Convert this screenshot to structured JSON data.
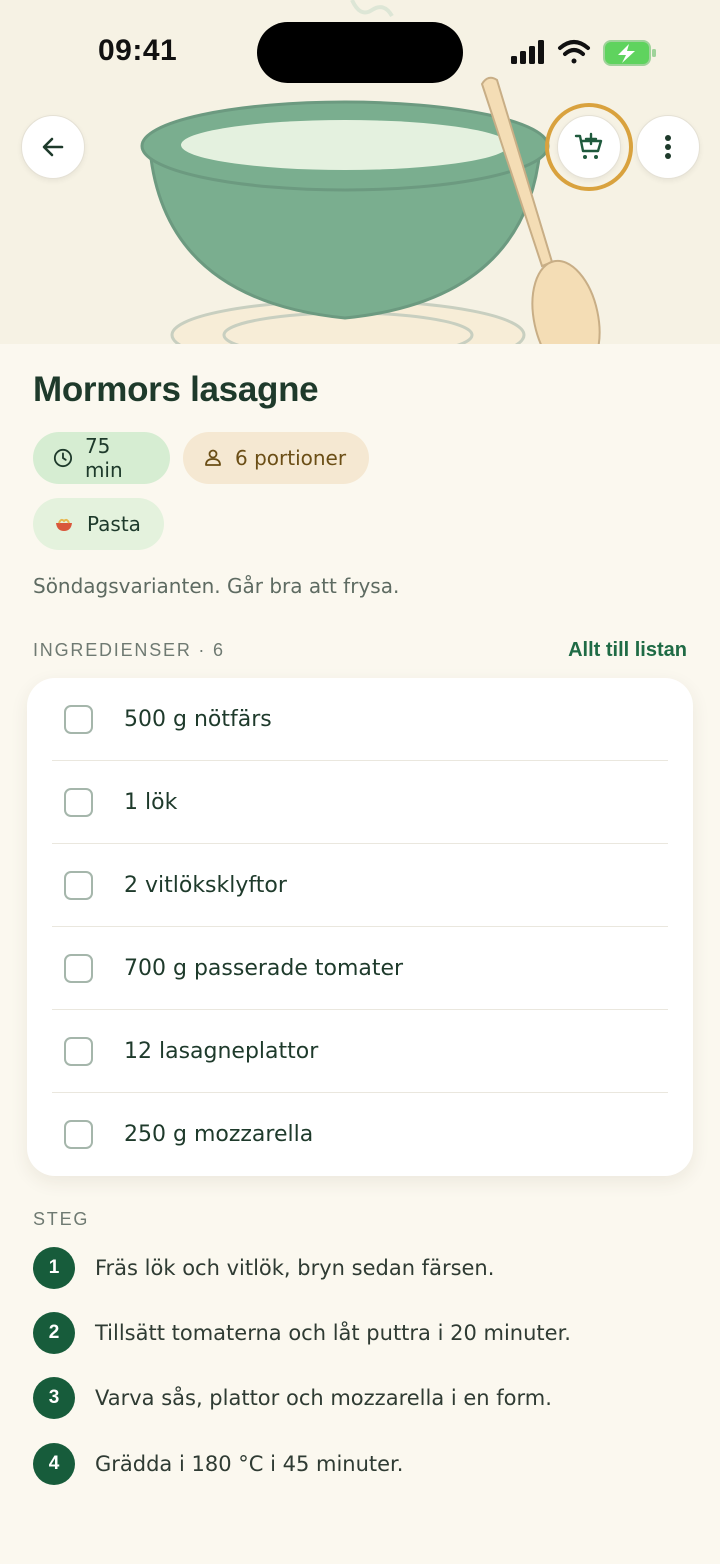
{
  "status": {
    "time": "09:41"
  },
  "recipe": {
    "title": "Mormors lasagne",
    "time": "75 min",
    "portions": "6 portioner",
    "category": "Pasta",
    "description": "Söndagsvarianten. Går bra att frysa."
  },
  "ingredients": {
    "label": "INGREDIENSER · 6",
    "all_to_list": "Allt till listan",
    "items": [
      {
        "text": "500 g nötfärs",
        "checked": false
      },
      {
        "text": "1 lök",
        "checked": false
      },
      {
        "text": "2 vitlöksklyftor",
        "checked": false
      },
      {
        "text": "700 g passerade tomater",
        "checked": false
      },
      {
        "text": "12 lasagneplattor",
        "checked": false
      },
      {
        "text": "250 g mozzarella",
        "checked": false
      }
    ]
  },
  "steps": {
    "label": "STEG",
    "items": [
      {
        "num": "1",
        "text": "Fräs lök och vitlök, bryn sedan färsen."
      },
      {
        "num": "2",
        "text": "Tillsätt tomaterna och låt puttra i 20 minuter."
      },
      {
        "num": "3",
        "text": "Varva sås, plattor och mozzarella i en form."
      },
      {
        "num": "4",
        "text": "Grädda i 180 °C i 45 minuter."
      }
    ]
  },
  "icons": {
    "back": "arrow-left-icon",
    "cart": "cart-plus-icon",
    "more": "more-vertical-icon",
    "clock": "clock-icon",
    "person": "person-icon",
    "category": "pasta-bowl-icon"
  },
  "colors": {
    "accent": "#1F6B45",
    "highlight_ring": "#D9A23E",
    "background": "#FBF8EF"
  }
}
